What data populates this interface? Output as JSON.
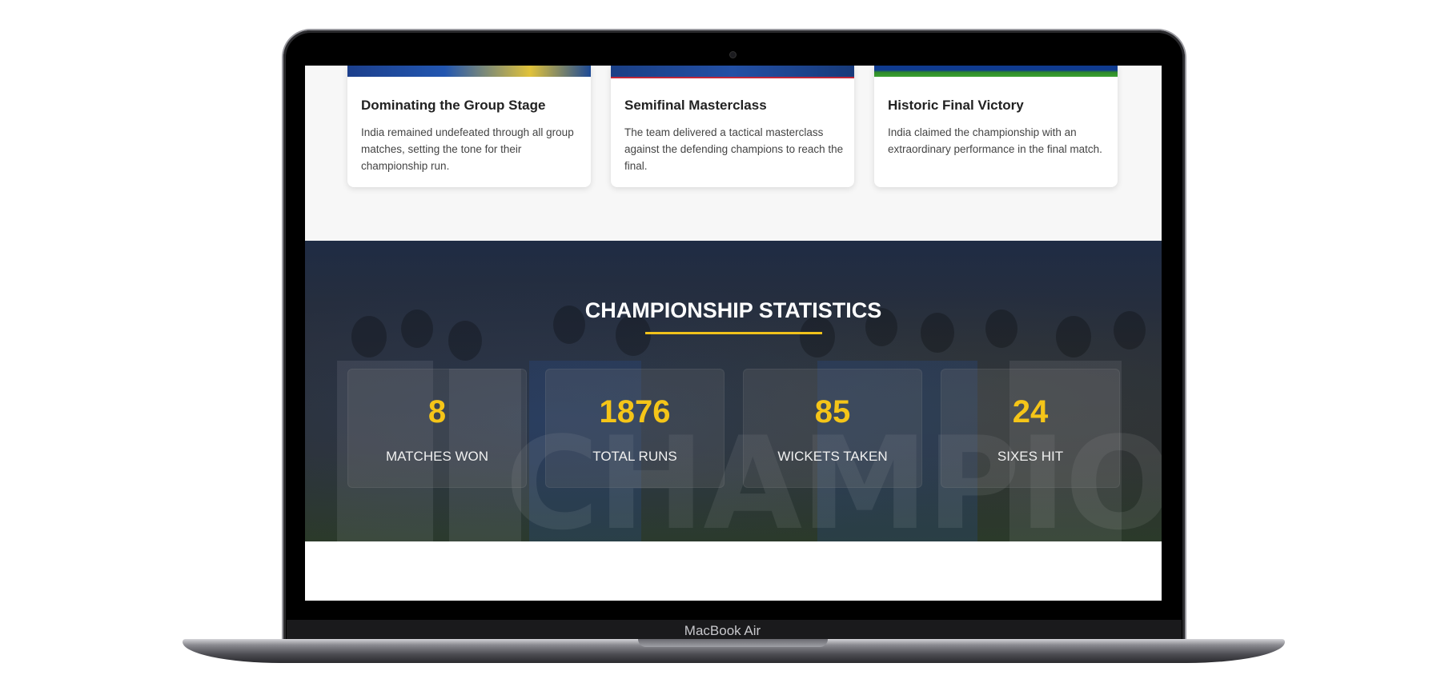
{
  "device": {
    "model_label": "MacBook Air"
  },
  "cards": [
    {
      "title": "Dominating the Group Stage",
      "text": "India remained undefeated through all group matches, setting the tone for their championship run."
    },
    {
      "title": "Semifinal Masterclass",
      "text": "The team delivered a tactical masterclass against the defending champions to reach the final."
    },
    {
      "title": "Historic Final Victory",
      "text": "India claimed the championship with an extraordinary performance in the final match."
    }
  ],
  "stats": {
    "title": "CHAMPIONSHIP STATISTICS",
    "background_word": "CHAMPIONS",
    "accent_color": "#f1c21b",
    "items": [
      {
        "value": "8",
        "label": "MATCHES WON"
      },
      {
        "value": "1876",
        "label": "TOTAL RUNS"
      },
      {
        "value": "85",
        "label": "WICKETS TAKEN"
      },
      {
        "value": "24",
        "label": "SIXES HIT"
      }
    ]
  }
}
